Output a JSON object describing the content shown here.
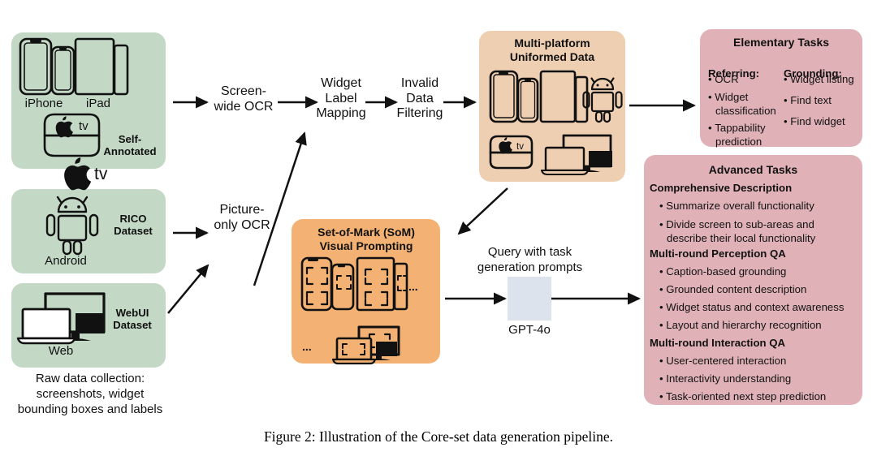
{
  "figure": {
    "caption": "Figure 2: Illustration of the Core-set data generation pipeline."
  },
  "colors": {
    "green": "#c3d8c5",
    "peach": "#efcfb2",
    "orange": "#f3b273",
    "pink": "#e0b2b8",
    "gpt_logo_bg": "#dde3ec",
    "stroke": "#111111",
    "background": "#ffffff"
  },
  "sources": {
    "caption": "Raw data collection:\nscreenshots, widget\nbounding boxes and labels",
    "boxes": [
      {
        "id": "self-annotated",
        "tag": "Self-\nAnnotated",
        "device_labels": [
          "iPhone",
          "iPad",
          "tv"
        ],
        "icons": [
          "iphone-icon",
          "ipad-icon",
          "apple-tv-icon"
        ]
      },
      {
        "id": "rico",
        "tag": "RICO\nDataset",
        "device_labels": [
          "Android"
        ],
        "icons": [
          "android-icon"
        ]
      },
      {
        "id": "webui",
        "tag": "WebUI\nDataset",
        "device_labels": [
          "Web"
        ],
        "icons": [
          "desktop-laptop-icon"
        ]
      }
    ]
  },
  "pipeline": {
    "steps": [
      {
        "id": "screen-wide-ocr",
        "label": "Screen-\nwide OCR"
      },
      {
        "id": "widget-label-mapping",
        "label": "Widget\nLabel\nMapping"
      },
      {
        "id": "invalid-data-filtering",
        "label": "Invalid\nData\nFiltering"
      },
      {
        "id": "picture-only-ocr",
        "label": "Picture-\nonly OCR"
      }
    ]
  },
  "uniformed": {
    "title": "Multi-platform\nUniformed Data",
    "icons": [
      "iphone-icon",
      "ipad-icon",
      "android-icon",
      "apple-tv-icon",
      "desktop-laptop-icon"
    ]
  },
  "som": {
    "title": "Set-of-Mark (SoM)\nVisual Prompting",
    "ellipsis_right": "...",
    "ellipsis_left": "...",
    "icons": [
      "iphone-marked-icon",
      "ipad-marked-icon",
      "desktop-laptop-marked-icon"
    ]
  },
  "gpt": {
    "query_label": "Query with task\ngeneration prompts",
    "model_label": "GPT-4o",
    "logo": "openai-icon"
  },
  "elementary": {
    "title": "Elementary Tasks",
    "columns": [
      {
        "heading": "Referring",
        "heading_suffix": ":",
        "items": [
          "OCR",
          "Widget\nclassification",
          "Tappability\nprediction"
        ]
      },
      {
        "heading": "Grounding",
        "heading_suffix": ":",
        "items": [
          "Widget listing",
          "Find text",
          "Find widget"
        ]
      }
    ]
  },
  "advanced": {
    "title": "Advanced Tasks",
    "groups": [
      {
        "heading": "Comprehensive Description",
        "items": [
          "Summarize overall functionality",
          "Divide screen to sub-areas and\ndescribe their local functionality"
        ]
      },
      {
        "heading": "Multi-round Perception QA",
        "items": [
          "Caption-based grounding",
          "Grounded content description",
          "Widget status and context awareness",
          "Layout and hierarchy recognition"
        ]
      },
      {
        "heading": "Multi-round Interaction QA",
        "items": [
          "User-centered interaction",
          "Interactivity understanding",
          "Task-oriented next step prediction"
        ]
      }
    ]
  }
}
